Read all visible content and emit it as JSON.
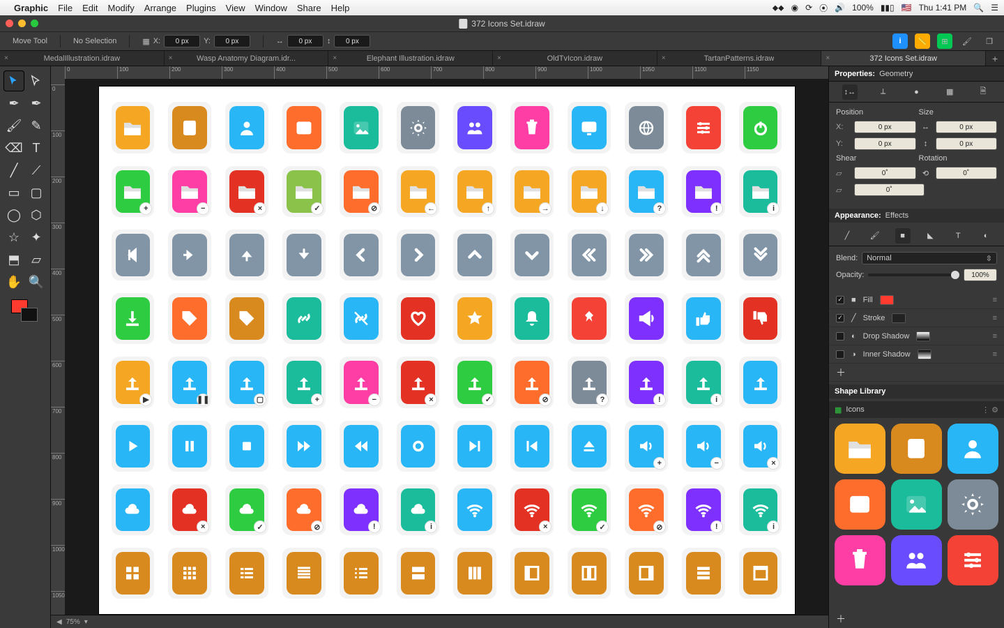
{
  "menu": {
    "app": "Graphic",
    "items": [
      "File",
      "Edit",
      "Modify",
      "Arrange",
      "Plugins",
      "View",
      "Window",
      "Share",
      "Help"
    ],
    "battery": "100%",
    "clock": "Thu 1:41 PM"
  },
  "window": {
    "title": "372 Icons Set.idraw"
  },
  "optbar": {
    "tool": "Move Tool",
    "sel": "No Selection",
    "x": "0 px",
    "y": "0 px",
    "w": "0 px",
    "h": "0 px"
  },
  "tabs": {
    "items": [
      "MedalIllustration.idraw",
      "Wasp Anatomy Diagram.idr...",
      "Elephant Illustration.idraw",
      "OldTvIcon.idraw",
      "TartanPatterns.idraw",
      "372 Icons Set.idraw"
    ],
    "active": 5
  },
  "status": {
    "zoom": "75%"
  },
  "inspector": {
    "header": "Properties:",
    "sub": "Geometry",
    "pos_label": "Position",
    "size_label": "Size",
    "x": "0 px",
    "y": "0 px",
    "w": "0 px",
    "h": "0 px",
    "shear_label": "Shear",
    "shear1": "0˚",
    "shear2": "0˚",
    "rot_label": "Rotation",
    "rot": "0˚",
    "app_label": "Appearance:",
    "app_sub": "Effects",
    "blend_label": "Blend:",
    "blend_val": "Normal",
    "op_label": "Opacity:",
    "op_val": "100%",
    "fill": "Fill",
    "stroke": "Stroke",
    "dshadow": "Drop Shadow",
    "ishadow": "Inner Shadow",
    "lib_label": "Shape Library",
    "lib_sel": "Icons"
  },
  "ruler_h": [
    "0",
    "100",
    "200",
    "300",
    "400",
    "500",
    "600",
    "700",
    "800",
    "900",
    "1000",
    "1050",
    "1100",
    "1150"
  ],
  "ruler_v": [
    "0",
    "100",
    "200",
    "300",
    "400",
    "500",
    "600",
    "700",
    "800",
    "900",
    "1000",
    "1050"
  ],
  "icons": [
    [
      {
        "c": "c-orange",
        "s": "folder"
      },
      {
        "c": "c-amber",
        "s": "doc"
      },
      {
        "c": "c-blue",
        "s": "user"
      },
      {
        "c": "c-orangeo",
        "s": "table"
      },
      {
        "c": "c-teal",
        "s": "image"
      },
      {
        "c": "c-gray",
        "s": "gear"
      },
      {
        "c": "c-purple",
        "s": "people"
      },
      {
        "c": "c-pink",
        "s": "trash"
      },
      {
        "c": "c-blue",
        "s": "monitor"
      },
      {
        "c": "c-gray",
        "s": "globe"
      },
      {
        "c": "c-red",
        "s": "sliders"
      },
      {
        "c": "c-green",
        "s": "power"
      }
    ],
    [
      {
        "c": "c-green",
        "s": "folder",
        "b": "+"
      },
      {
        "c": "c-pink",
        "s": "folder",
        "b": "−"
      },
      {
        "c": "c-redd",
        "s": "folder",
        "b": "×"
      },
      {
        "c": "c-lime",
        "s": "folder",
        "b": "✓"
      },
      {
        "c": "c-orangeo",
        "s": "folder",
        "b": "⊘"
      },
      {
        "c": "c-orange",
        "s": "folder",
        "b": "←"
      },
      {
        "c": "c-orange",
        "s": "folder",
        "b": "↑"
      },
      {
        "c": "c-orange",
        "s": "folder",
        "b": "→"
      },
      {
        "c": "c-orange",
        "s": "folder",
        "b": "↓"
      },
      {
        "c": "c-blue",
        "s": "folder",
        "b": "?"
      },
      {
        "c": "c-violet",
        "s": "folder",
        "b": "!"
      },
      {
        "c": "c-teal",
        "s": "folder",
        "b": "i"
      }
    ],
    [
      {
        "c": "c-slate",
        "s": "aleft"
      },
      {
        "c": "c-slate",
        "s": "aright"
      },
      {
        "c": "c-slate",
        "s": "aup"
      },
      {
        "c": "c-slate",
        "s": "adown"
      },
      {
        "c": "c-slate",
        "s": "cleft"
      },
      {
        "c": "c-slate",
        "s": "cright"
      },
      {
        "c": "c-slate",
        "s": "cup"
      },
      {
        "c": "c-slate",
        "s": "cdown"
      },
      {
        "c": "c-slate",
        "s": "dleft"
      },
      {
        "c": "c-slate",
        "s": "dright"
      },
      {
        "c": "c-slate",
        "s": "dup"
      },
      {
        "c": "c-slate",
        "s": "ddown"
      }
    ],
    [
      {
        "c": "c-green",
        "s": "download"
      },
      {
        "c": "c-orangeo",
        "s": "tag"
      },
      {
        "c": "c-amber",
        "s": "tag"
      },
      {
        "c": "c-teal",
        "s": "link"
      },
      {
        "c": "c-blue",
        "s": "unlink"
      },
      {
        "c": "c-redd",
        "s": "heart"
      },
      {
        "c": "c-orange",
        "s": "star"
      },
      {
        "c": "c-teal",
        "s": "bell"
      },
      {
        "c": "c-red",
        "s": "pin"
      },
      {
        "c": "c-violet",
        "s": "horn"
      },
      {
        "c": "c-blue",
        "s": "thumbu"
      },
      {
        "c": "c-redd",
        "s": "thumbd"
      }
    ],
    [
      {
        "c": "c-orange",
        "s": "upload",
        "b": "▶"
      },
      {
        "c": "c-blue",
        "s": "upload",
        "b": "❚❚"
      },
      {
        "c": "c-blue",
        "s": "upload",
        "b": "▢"
      },
      {
        "c": "c-teal",
        "s": "upload",
        "b": "+"
      },
      {
        "c": "c-pink",
        "s": "upload",
        "b": "−"
      },
      {
        "c": "c-redd",
        "s": "upload",
        "b": "×"
      },
      {
        "c": "c-green",
        "s": "upload",
        "b": "✓"
      },
      {
        "c": "c-orangeo",
        "s": "upload",
        "b": "⊘"
      },
      {
        "c": "c-gray",
        "s": "upload",
        "b": "?"
      },
      {
        "c": "c-violet",
        "s": "upload",
        "b": "!"
      },
      {
        "c": "c-teal",
        "s": "upload",
        "b": "i"
      },
      {
        "c": "c-blue",
        "s": "upload"
      }
    ],
    [
      {
        "c": "c-blue",
        "s": "play"
      },
      {
        "c": "c-blue",
        "s": "pause"
      },
      {
        "c": "c-blue",
        "s": "stop"
      },
      {
        "c": "c-blue",
        "s": "ffwd"
      },
      {
        "c": "c-blue",
        "s": "rrwd"
      },
      {
        "c": "c-blue",
        "s": "rec"
      },
      {
        "c": "c-blue",
        "s": "next"
      },
      {
        "c": "c-blue",
        "s": "prev"
      },
      {
        "c": "c-blue",
        "s": "eject"
      },
      {
        "c": "c-blue",
        "s": "vol",
        "b": "+"
      },
      {
        "c": "c-blue",
        "s": "vol",
        "b": "−"
      },
      {
        "c": "c-blue",
        "s": "vol",
        "b": "×"
      }
    ],
    [
      {
        "c": "c-blue",
        "s": "cloud"
      },
      {
        "c": "c-redd",
        "s": "cloud",
        "b": "×"
      },
      {
        "c": "c-green",
        "s": "cloud",
        "b": "✓"
      },
      {
        "c": "c-orangeo",
        "s": "cloud",
        "b": "⊘"
      },
      {
        "c": "c-violet",
        "s": "cloud",
        "b": "!"
      },
      {
        "c": "c-teal",
        "s": "cloud",
        "b": "i"
      },
      {
        "c": "c-blue",
        "s": "wifi"
      },
      {
        "c": "c-redd",
        "s": "wifi",
        "b": "×"
      },
      {
        "c": "c-green",
        "s": "wifi",
        "b": "✓"
      },
      {
        "c": "c-orangeo",
        "s": "wifi",
        "b": "⊘"
      },
      {
        "c": "c-violet",
        "s": "wifi",
        "b": "!"
      },
      {
        "c": "c-teal",
        "s": "wifi",
        "b": "i"
      }
    ],
    [
      {
        "c": "c-amber",
        "s": "g4"
      },
      {
        "c": "c-amber",
        "s": "g9"
      },
      {
        "c": "c-amber",
        "s": "list"
      },
      {
        "c": "c-amber",
        "s": "just"
      },
      {
        "c": "c-amber",
        "s": "listn"
      },
      {
        "c": "c-amber",
        "s": "rows"
      },
      {
        "c": "c-amber",
        "s": "cols"
      },
      {
        "c": "c-amber",
        "s": "colL"
      },
      {
        "c": "c-amber",
        "s": "colC"
      },
      {
        "c": "c-amber",
        "s": "colR"
      },
      {
        "c": "c-amber",
        "s": "stack"
      },
      {
        "c": "c-amber",
        "s": "frame"
      }
    ]
  ],
  "lib_icons": [
    {
      "c": "c-orange",
      "s": "folder"
    },
    {
      "c": "c-amber",
      "s": "doc"
    },
    {
      "c": "c-blue",
      "s": "user"
    },
    {
      "c": "c-orangeo",
      "s": "table"
    },
    {
      "c": "c-teal",
      "s": "image"
    },
    {
      "c": "c-gray",
      "s": "gear"
    },
    {
      "c": "c-pink",
      "s": "trash"
    },
    {
      "c": "c-purple",
      "s": "people"
    },
    {
      "c": "c-red",
      "s": "sliders"
    }
  ]
}
